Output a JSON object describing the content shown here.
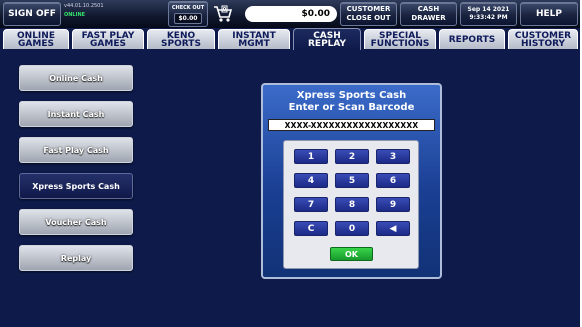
{
  "topbar": {
    "sign_off": "SIGN OFF",
    "version": "v44.01.10.2501",
    "status": "ONLINE",
    "checkout_label": "CHECK OUT",
    "checkout_amount": "$0.00",
    "cart_icon": "shopping-cart-icon",
    "amount": "$0.00",
    "customer_close_out": "CUSTOMER\nCLOSE OUT",
    "cash_drawer": "CASH\nDRAWER",
    "date": "Sep 14 2021",
    "time": "9:33:42 PM",
    "help": "HELP"
  },
  "tabs": [
    {
      "label": "ONLINE\nGAMES",
      "active": false
    },
    {
      "label": "FAST PLAY\nGAMES",
      "active": false
    },
    {
      "label": "KENO\nSPORTS",
      "active": false
    },
    {
      "label": "INSTANT\nMGMT",
      "active": false
    },
    {
      "label": "CASH\nREPLAY",
      "active": true
    },
    {
      "label": "SPECIAL\nFUNCTIONS",
      "active": false
    },
    {
      "label": "REPORTS",
      "active": false
    },
    {
      "label": "CUSTOMER\nHISTORY",
      "active": false
    }
  ],
  "side_menu": [
    {
      "label": "Online Cash",
      "selected": false
    },
    {
      "label": "Instant Cash",
      "selected": false
    },
    {
      "label": "Fast Play Cash",
      "selected": false
    },
    {
      "label": "Xpress Sports Cash",
      "selected": true
    },
    {
      "label": "Voucher Cash",
      "selected": false
    },
    {
      "label": "Replay",
      "selected": false
    }
  ],
  "dialog": {
    "title": "Xpress Sports Cash",
    "subtitle": "Enter or Scan Barcode",
    "barcode_value": "XXXX-XXXXXXXXXXXXXXXXXX",
    "keys": [
      "1",
      "2",
      "3",
      "4",
      "5",
      "6",
      "7",
      "8",
      "9",
      "C",
      "0",
      "◀"
    ],
    "ok_label": "OK"
  },
  "colors": {
    "background": "#0e1a4a",
    "dialog": "#1a3f93",
    "key": "#2a3aa0",
    "ok": "#26b83a",
    "status_online": "#35e06a"
  }
}
